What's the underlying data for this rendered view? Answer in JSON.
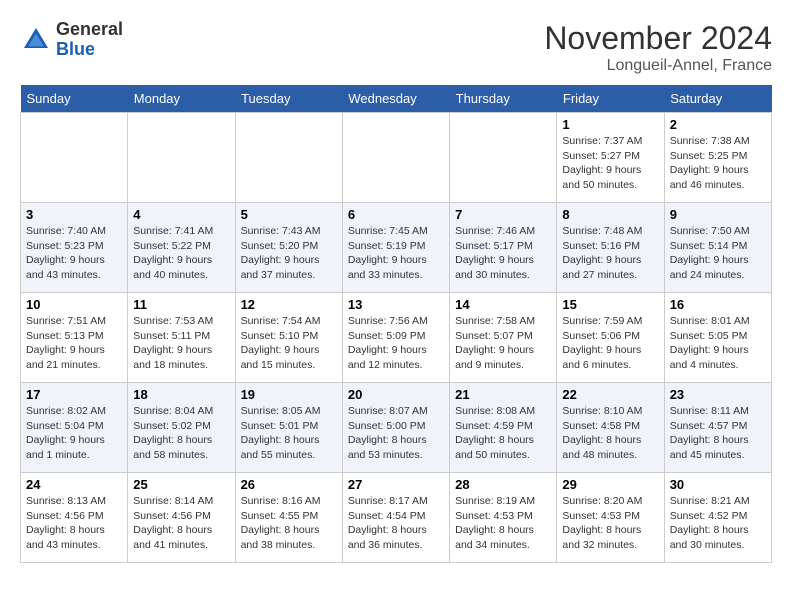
{
  "header": {
    "logo_line1": "General",
    "logo_line2": "Blue",
    "month_title": "November 2024",
    "location": "Longueil-Annel, France"
  },
  "weekdays": [
    "Sunday",
    "Monday",
    "Tuesday",
    "Wednesday",
    "Thursday",
    "Friday",
    "Saturday"
  ],
  "weeks": [
    [
      {
        "day": "",
        "info": ""
      },
      {
        "day": "",
        "info": ""
      },
      {
        "day": "",
        "info": ""
      },
      {
        "day": "",
        "info": ""
      },
      {
        "day": "",
        "info": ""
      },
      {
        "day": "1",
        "info": "Sunrise: 7:37 AM\nSunset: 5:27 PM\nDaylight: 9 hours\nand 50 minutes."
      },
      {
        "day": "2",
        "info": "Sunrise: 7:38 AM\nSunset: 5:25 PM\nDaylight: 9 hours\nand 46 minutes."
      }
    ],
    [
      {
        "day": "3",
        "info": "Sunrise: 7:40 AM\nSunset: 5:23 PM\nDaylight: 9 hours\nand 43 minutes."
      },
      {
        "day": "4",
        "info": "Sunrise: 7:41 AM\nSunset: 5:22 PM\nDaylight: 9 hours\nand 40 minutes."
      },
      {
        "day": "5",
        "info": "Sunrise: 7:43 AM\nSunset: 5:20 PM\nDaylight: 9 hours\nand 37 minutes."
      },
      {
        "day": "6",
        "info": "Sunrise: 7:45 AM\nSunset: 5:19 PM\nDaylight: 9 hours\nand 33 minutes."
      },
      {
        "day": "7",
        "info": "Sunrise: 7:46 AM\nSunset: 5:17 PM\nDaylight: 9 hours\nand 30 minutes."
      },
      {
        "day": "8",
        "info": "Sunrise: 7:48 AM\nSunset: 5:16 PM\nDaylight: 9 hours\nand 27 minutes."
      },
      {
        "day": "9",
        "info": "Sunrise: 7:50 AM\nSunset: 5:14 PM\nDaylight: 9 hours\nand 24 minutes."
      }
    ],
    [
      {
        "day": "10",
        "info": "Sunrise: 7:51 AM\nSunset: 5:13 PM\nDaylight: 9 hours\nand 21 minutes."
      },
      {
        "day": "11",
        "info": "Sunrise: 7:53 AM\nSunset: 5:11 PM\nDaylight: 9 hours\nand 18 minutes."
      },
      {
        "day": "12",
        "info": "Sunrise: 7:54 AM\nSunset: 5:10 PM\nDaylight: 9 hours\nand 15 minutes."
      },
      {
        "day": "13",
        "info": "Sunrise: 7:56 AM\nSunset: 5:09 PM\nDaylight: 9 hours\nand 12 minutes."
      },
      {
        "day": "14",
        "info": "Sunrise: 7:58 AM\nSunset: 5:07 PM\nDaylight: 9 hours\nand 9 minutes."
      },
      {
        "day": "15",
        "info": "Sunrise: 7:59 AM\nSunset: 5:06 PM\nDaylight: 9 hours\nand 6 minutes."
      },
      {
        "day": "16",
        "info": "Sunrise: 8:01 AM\nSunset: 5:05 PM\nDaylight: 9 hours\nand 4 minutes."
      }
    ],
    [
      {
        "day": "17",
        "info": "Sunrise: 8:02 AM\nSunset: 5:04 PM\nDaylight: 9 hours\nand 1 minute."
      },
      {
        "day": "18",
        "info": "Sunrise: 8:04 AM\nSunset: 5:02 PM\nDaylight: 8 hours\nand 58 minutes."
      },
      {
        "day": "19",
        "info": "Sunrise: 8:05 AM\nSunset: 5:01 PM\nDaylight: 8 hours\nand 55 minutes."
      },
      {
        "day": "20",
        "info": "Sunrise: 8:07 AM\nSunset: 5:00 PM\nDaylight: 8 hours\nand 53 minutes."
      },
      {
        "day": "21",
        "info": "Sunrise: 8:08 AM\nSunset: 4:59 PM\nDaylight: 8 hours\nand 50 minutes."
      },
      {
        "day": "22",
        "info": "Sunrise: 8:10 AM\nSunset: 4:58 PM\nDaylight: 8 hours\nand 48 minutes."
      },
      {
        "day": "23",
        "info": "Sunrise: 8:11 AM\nSunset: 4:57 PM\nDaylight: 8 hours\nand 45 minutes."
      }
    ],
    [
      {
        "day": "24",
        "info": "Sunrise: 8:13 AM\nSunset: 4:56 PM\nDaylight: 8 hours\nand 43 minutes."
      },
      {
        "day": "25",
        "info": "Sunrise: 8:14 AM\nSunset: 4:56 PM\nDaylight: 8 hours\nand 41 minutes."
      },
      {
        "day": "26",
        "info": "Sunrise: 8:16 AM\nSunset: 4:55 PM\nDaylight: 8 hours\nand 38 minutes."
      },
      {
        "day": "27",
        "info": "Sunrise: 8:17 AM\nSunset: 4:54 PM\nDaylight: 8 hours\nand 36 minutes."
      },
      {
        "day": "28",
        "info": "Sunrise: 8:19 AM\nSunset: 4:53 PM\nDaylight: 8 hours\nand 34 minutes."
      },
      {
        "day": "29",
        "info": "Sunrise: 8:20 AM\nSunset: 4:53 PM\nDaylight: 8 hours\nand 32 minutes."
      },
      {
        "day": "30",
        "info": "Sunrise: 8:21 AM\nSunset: 4:52 PM\nDaylight: 8 hours\nand 30 minutes."
      }
    ]
  ]
}
